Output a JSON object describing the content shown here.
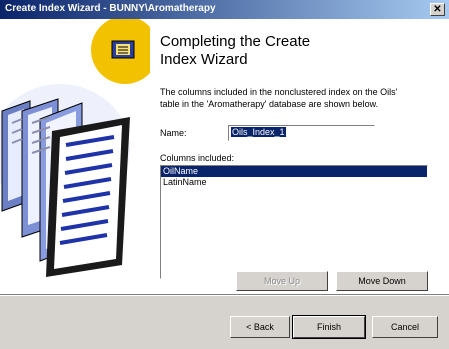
{
  "window": {
    "title": "Create Index Wizard - BUNNY\\Aromatherapy",
    "close_glyph": "✕"
  },
  "main": {
    "heading": "Completing the Create\nIndex Wizard",
    "description": "The columns included in the nonclustered index on the Oils'\ntable in the 'Aromatherapy' database are shown below.",
    "name_label": "Name:",
    "name_value": "Oils_Index_1",
    "columns_label": "Columns included:",
    "columns": [
      "OilName",
      "LatinName"
    ],
    "selected_column": "OilName"
  },
  "buttons": {
    "move_up": "Move Up",
    "move_down": "Move Down",
    "back": "< Back",
    "finish": "Finish",
    "cancel": "Cancel"
  },
  "colors": {
    "selection": "#0a246a",
    "titlebar_start": "#0a246a",
    "titlebar_end": "#a6caf0",
    "face": "#d6d3ce"
  },
  "icons": {
    "wizard_icon": "index-book-icon",
    "side_art": "document-pages-illustration"
  }
}
